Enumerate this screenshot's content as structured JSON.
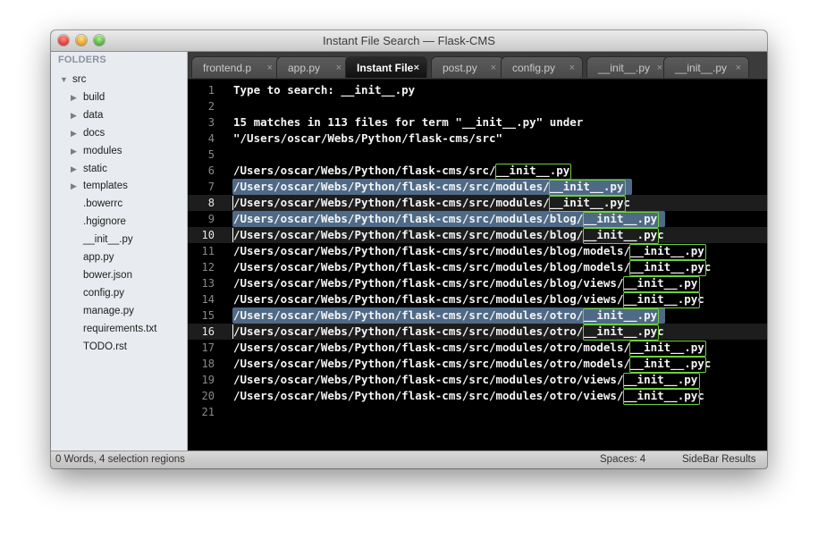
{
  "window": {
    "title": "Instant File Search — Flask-CMS"
  },
  "sidebar": {
    "header": "FOLDERS",
    "items": [
      {
        "label": "src",
        "expanded": true
      },
      {
        "label": "build"
      },
      {
        "label": "data"
      },
      {
        "label": "docs"
      },
      {
        "label": "modules"
      },
      {
        "label": "static"
      },
      {
        "label": "templates"
      },
      {
        "label": ".bowerrc"
      },
      {
        "label": ".hgignore"
      },
      {
        "label": "__init__.py"
      },
      {
        "label": "app.py"
      },
      {
        "label": "bower.json"
      },
      {
        "label": "config.py"
      },
      {
        "label": "manage.py"
      },
      {
        "label": "requirements.txt"
      },
      {
        "label": "TODO.rst"
      }
    ]
  },
  "tabs": [
    {
      "label": "frontend.p",
      "close": "×"
    },
    {
      "label": "app.py",
      "close": "×"
    },
    {
      "label": "Instant File",
      "close": "×",
      "active": true
    },
    {
      "label": "post.py",
      "close": "×"
    },
    {
      "label": "config.py",
      "close": "×"
    },
    {
      "label": "__init__.py",
      "close": "×"
    },
    {
      "label": "__init__.py",
      "close": "×"
    }
  ],
  "editor": {
    "lines": [
      "Type to search: __init__.py",
      "",
      "15 matches in 113 files for term \"__init__.py\" under",
      "\"/Users/oscar/Webs/Python/flask-cms/src\"",
      "",
      "/Users/oscar/Webs/Python/flask-cms/src/__init__.py",
      "/Users/oscar/Webs/Python/flask-cms/src/modules/__init__.py",
      "/Users/oscar/Webs/Python/flask-cms/src/modules/__init__.pyc",
      "/Users/oscar/Webs/Python/flask-cms/src/modules/blog/__init__.py",
      "/Users/oscar/Webs/Python/flask-cms/src/modules/blog/__init__.pyc",
      "/Users/oscar/Webs/Python/flask-cms/src/modules/blog/models/__init__.py",
      "/Users/oscar/Webs/Python/flask-cms/src/modules/blog/models/__init__.pyc",
      "/Users/oscar/Webs/Python/flask-cms/src/modules/blog/views/__init__.py",
      "/Users/oscar/Webs/Python/flask-cms/src/modules/blog/views/__init__.pyc",
      "/Users/oscar/Webs/Python/flask-cms/src/modules/otro/__init__.py",
      "/Users/oscar/Webs/Python/flask-cms/src/modules/otro/__init__.pyc",
      "/Users/oscar/Webs/Python/flask-cms/src/modules/otro/models/__init__.py",
      "/Users/oscar/Webs/Python/flask-cms/src/modules/otro/models/__init__.pyc",
      "/Users/oscar/Webs/Python/flask-cms/src/modules/otro/views/__init__.py",
      "/Users/oscar/Webs/Python/flask-cms/src/modules/otro/views/__init__.pyc",
      ""
    ],
    "line_numbers": [
      "1",
      "2",
      "3",
      "4",
      "5",
      "6",
      "7",
      "8",
      "9",
      "10",
      "11",
      "12",
      "13",
      "14",
      "15",
      "16",
      "17",
      "18",
      "19",
      "20",
      "21"
    ],
    "selected_lines": [
      7,
      9,
      15
    ],
    "current_lines": [
      8,
      10,
      16
    ],
    "match_term": "__init__.py"
  },
  "statusbar": {
    "left": "0 Words, 4 selection regions",
    "spaces": "Spaces: 4",
    "syntax": "SideBar Results"
  },
  "colors": {
    "selection": "#4f6a86",
    "match_outline": "#6fcf3a",
    "editor_bg": "#000000"
  }
}
